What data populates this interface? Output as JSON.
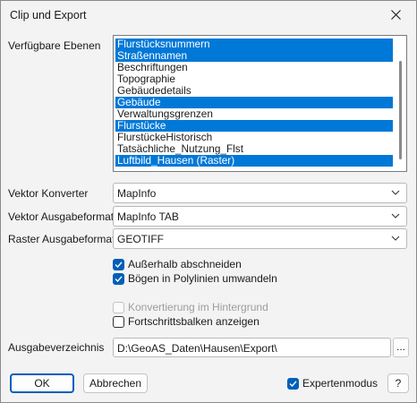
{
  "window": {
    "title": "Clip und Export"
  },
  "layers": {
    "label": "Verfügbare Ebenen",
    "items": [
      {
        "name": "Flurstücksnummern",
        "selected": true
      },
      {
        "name": "Straßennamen",
        "selected": true
      },
      {
        "name": "Beschriftungen",
        "selected": false
      },
      {
        "name": "Topographie",
        "selected": false
      },
      {
        "name": "Gebäudedetails",
        "selected": false
      },
      {
        "name": "Gebäude",
        "selected": true
      },
      {
        "name": "Verwaltungsgrenzen",
        "selected": false
      },
      {
        "name": "Flurstücke",
        "selected": true
      },
      {
        "name": "FlurstückeHistorisch",
        "selected": false
      },
      {
        "name": "Tatsächliche_Nutzung_Flst",
        "selected": false
      },
      {
        "name": "Luftbild_Hausen (Raster)",
        "selected": true
      }
    ]
  },
  "vector_converter": {
    "label": "Vektor Konverter",
    "value": "MapInfo"
  },
  "vector_format": {
    "label": "Vektor Ausgabeformat",
    "value": "MapInfo TAB"
  },
  "raster_format": {
    "label": "Raster Ausgabeformat",
    "value": "GEOTIFF"
  },
  "options": {
    "clip_outside": {
      "label": "Außerhalb abschneiden",
      "checked": true
    },
    "arcs_to_polylines": {
      "label": "Bögen in Polylinien umwandeln",
      "checked": true
    },
    "background_conversion": {
      "label": "Konvertierung im Hintergrund",
      "checked": false,
      "disabled": true
    },
    "show_progress": {
      "label": "Fortschrittsbalken anzeigen",
      "checked": false
    }
  },
  "output_dir": {
    "label": "Ausgabeverzeichnis",
    "value": "D:\\GeoAS_Daten\\Hausen\\Export\\",
    "browse_label": "..."
  },
  "footer": {
    "ok_label": "OK",
    "cancel_label": "Abbrechen",
    "expert_mode": {
      "label": "Expertenmodus",
      "checked": true
    },
    "help_label": "?"
  },
  "colors": {
    "selection": "#0078d7",
    "accent": "#005fb8"
  }
}
